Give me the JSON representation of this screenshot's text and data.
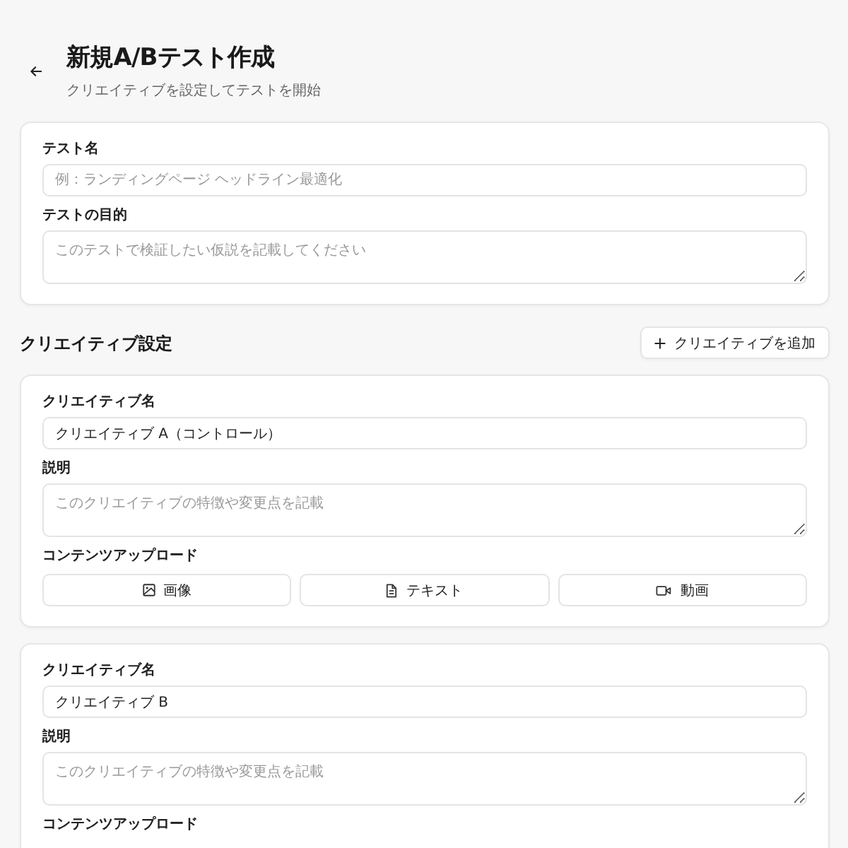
{
  "header": {
    "title": "新規A/Bテスト作成",
    "subtitle": "クリエイティブを設定してテストを開始"
  },
  "test_form": {
    "fields": [
      {
        "kind": "input",
        "label": "テスト名",
        "placeholder": "例：ランディングページ ヘッドライン最適化"
      },
      {
        "kind": "textarea",
        "label": "テストの目的",
        "placeholder": "このテストで検証したい仮説を記載してください"
      }
    ]
  },
  "creative_section": {
    "title": "クリエイティブ設定",
    "add_button": "クリエイティブを追加"
  },
  "creatives": [
    {
      "name_label": "クリエイティブ名",
      "name_value": "クリエイティブ A（コントロール）",
      "description_label": "説明",
      "description_placeholder": "このクリエイティブの特徴や変更点を記載",
      "upload_label": "コンテンツアップロード",
      "upload_buttons": [
        {
          "kind": "image",
          "label": "画像"
        },
        {
          "kind": "text",
          "label": "テキスト"
        },
        {
          "kind": "video",
          "label": "動画"
        }
      ]
    },
    {
      "name_label": "クリエイティブ名",
      "name_value": "クリエイティブ B",
      "description_label": "説明",
      "description_placeholder": "このクリエイティブの特徴や変更点を記載",
      "upload_label": "コンテンツアップロード"
    }
  ]
}
